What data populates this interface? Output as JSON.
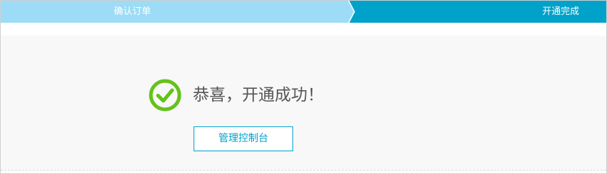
{
  "steps": [
    {
      "label": "确认订单",
      "state": "done",
      "color": "#9ddcf6"
    },
    {
      "label": "开通完成",
      "state": "current",
      "color": "#00a2ca"
    }
  ],
  "result": {
    "icon": "check-circle-icon",
    "icon_color": "#64c21a",
    "message": "恭喜，开通成功！"
  },
  "actions": {
    "console_button_label": "管理控制台",
    "accent_color": "#00a2ca"
  }
}
